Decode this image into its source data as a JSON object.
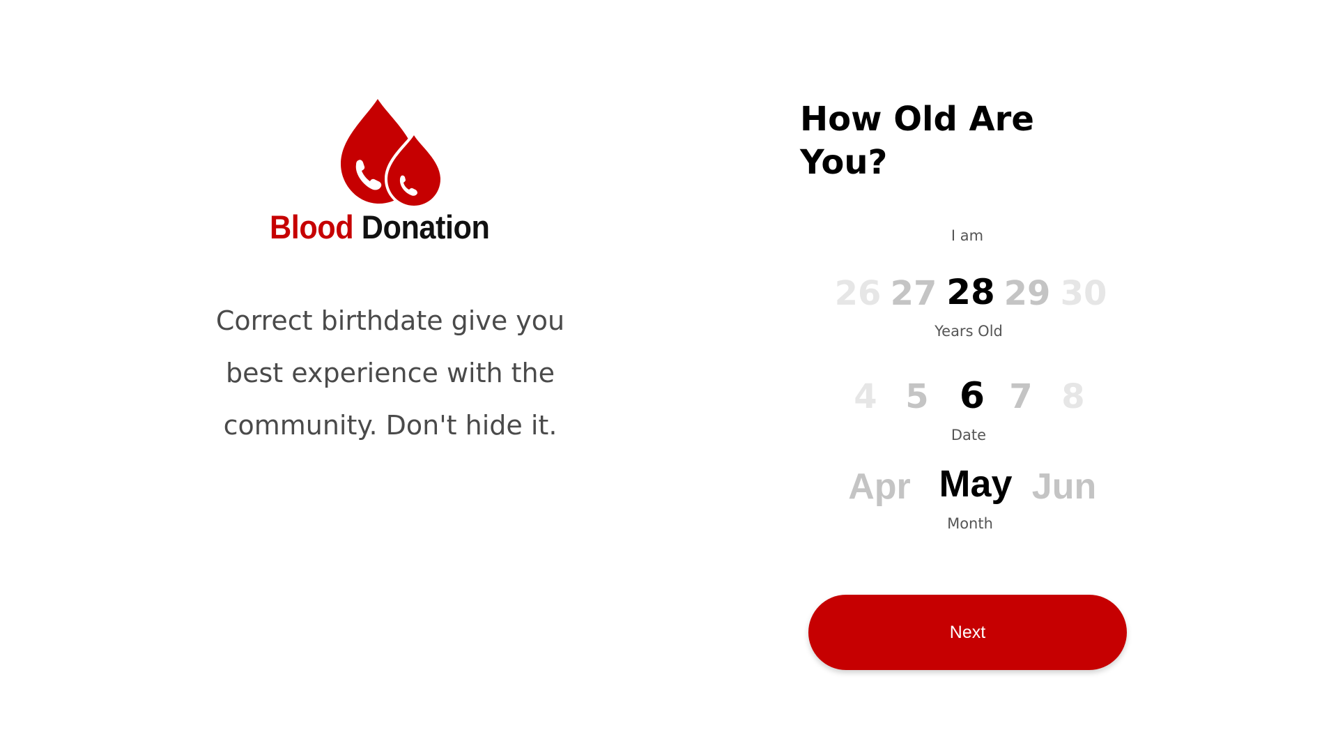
{
  "brand": {
    "word1": "Blood",
    "word2": "Donation",
    "primary_color": "#c60001",
    "icon": "blood-drops-phone-icon"
  },
  "intro": {
    "line1": "Correct birthdate give you",
    "line2": "best experience with the",
    "line3": "community. Don't hide it."
  },
  "form": {
    "title_line1": "How Old Are",
    "title_line2": "You?",
    "age_prefix": "I am",
    "age_picker": {
      "options": [
        "26",
        "27",
        "28",
        "29",
        "30"
      ],
      "selected": "28",
      "caption": "Years Old"
    },
    "date_picker": {
      "options": [
        "4",
        "5",
        "6",
        "7",
        "8"
      ],
      "selected": "6",
      "caption": "Date"
    },
    "month_picker": {
      "options": [
        "Apr",
        "May",
        "Jun"
      ],
      "selected": "May",
      "caption": "Month"
    },
    "next_label": "Next"
  }
}
